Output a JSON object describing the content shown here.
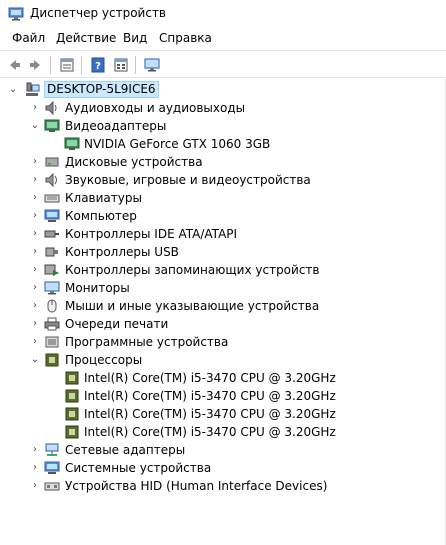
{
  "window": {
    "title": "Диспетчер устройств"
  },
  "menu": {
    "items": [
      "Файл",
      "Действие",
      "Вид",
      "Справка"
    ]
  },
  "toolbar": {
    "buttons": [
      "back-arrow-icon",
      "forward-arrow-icon",
      "properties-icon",
      "help-icon",
      "view-icon",
      "monitor-icon"
    ]
  },
  "tree": {
    "root": "DESKTOP-5L9ICE6",
    "categories": [
      {
        "label": "Аудиовходы и аудиовыходы",
        "icon": "speaker-icon",
        "expanded": false
      },
      {
        "label": "Видеоадаптеры",
        "icon": "display-adapter-icon",
        "expanded": true,
        "children": [
          "NVIDIA GeForce GTX 1060 3GB"
        ]
      },
      {
        "label": "Дисковые устройства",
        "icon": "disk-drive-icon",
        "expanded": false
      },
      {
        "label": "Звуковые, игровые и видеоустройства",
        "icon": "sound-icon",
        "expanded": false
      },
      {
        "label": "Клавиатуры",
        "icon": "keyboard-icon",
        "expanded": false
      },
      {
        "label": "Компьютер",
        "icon": "computer-icon",
        "expanded": false
      },
      {
        "label": "Контроллеры IDE ATA/ATAPI",
        "icon": "ide-controller-icon",
        "expanded": false
      },
      {
        "label": "Контроллеры USB",
        "icon": "usb-controller-icon",
        "expanded": false
      },
      {
        "label": "Контроллеры запоминающих устройств",
        "icon": "storage-controller-icon",
        "expanded": false
      },
      {
        "label": "Мониторы",
        "icon": "monitor-icon",
        "expanded": false
      },
      {
        "label": "Мыши и иные указывающие устройства",
        "icon": "mouse-icon",
        "expanded": false
      },
      {
        "label": "Очереди печати",
        "icon": "printer-icon",
        "expanded": false
      },
      {
        "label": "Программные устройства",
        "icon": "software-device-icon",
        "expanded": false
      },
      {
        "label": "Процессоры",
        "icon": "processor-icon",
        "expanded": true,
        "children": [
          "Intel(R) Core(TM) i5-3470 CPU @ 3.20GHz",
          "Intel(R) Core(TM) i5-3470 CPU @ 3.20GHz",
          "Intel(R) Core(TM) i5-3470 CPU @ 3.20GHz",
          "Intel(R) Core(TM) i5-3470 CPU @ 3.20GHz"
        ]
      },
      {
        "label": "Сетевые адаптеры",
        "icon": "network-adapter-icon",
        "expanded": false
      },
      {
        "label": "Системные устройства",
        "icon": "system-device-icon",
        "expanded": false
      },
      {
        "label": "Устройства HID (Human Interface Devices)",
        "icon": "hid-icon",
        "expanded": false
      }
    ]
  },
  "colors": {
    "selection_bg": "#cce8ff",
    "selection_border": "#99d1ff",
    "toggle": "#444444"
  }
}
